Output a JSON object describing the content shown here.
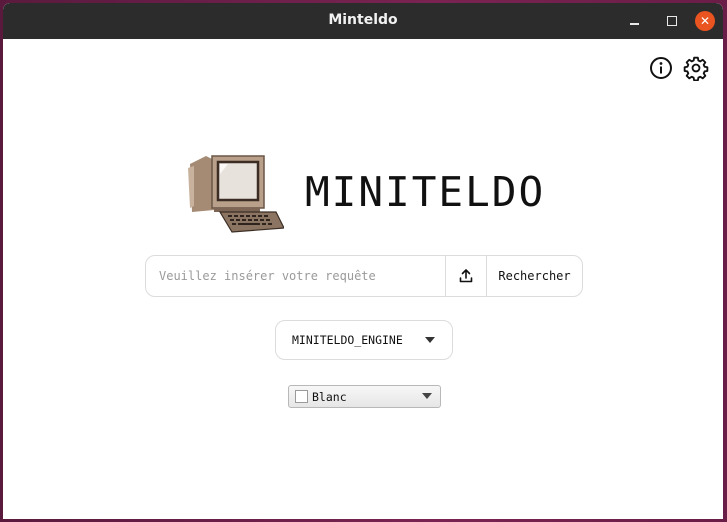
{
  "window": {
    "title": "Minteldo",
    "controls": {
      "minimize": "minimize-icon",
      "maximize": "maximize-icon",
      "close": "close-icon"
    }
  },
  "toolbar": {
    "info_icon": "info-icon",
    "settings_icon": "gear-icon"
  },
  "logo": {
    "text": "MINITELDO",
    "image": "minitel-computer-icon"
  },
  "search": {
    "placeholder": "Veuillez insérer votre requête",
    "value": "",
    "upload_icon": "upload-icon",
    "button_label": "Rechercher"
  },
  "engine_select": {
    "selected": "MINITELDO_ENGINE"
  },
  "color_select": {
    "selected": "Blanc",
    "swatch_color": "#ffffff"
  },
  "colors": {
    "titlebar": "#2c2c2c",
    "close_button": "#e95420",
    "desktop": "#6a1d47"
  }
}
